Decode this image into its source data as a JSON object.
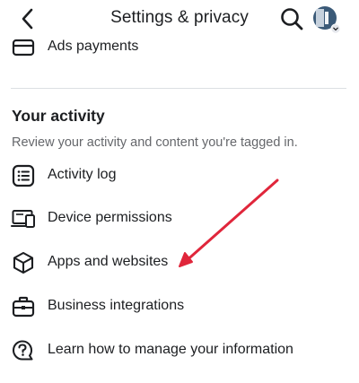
{
  "header": {
    "title": "Settings & privacy",
    "back_icon": "chevron-left-icon",
    "search_icon": "search-icon",
    "avatar_icon": "profile-avatar"
  },
  "top_item": {
    "label": "Ads payments",
    "icon": "card-icon"
  },
  "section": {
    "title": "Your activity",
    "subtitle": "Review your activity and content you're tagged in.",
    "items": [
      {
        "label": "Activity log",
        "icon": "list-icon"
      },
      {
        "label": "Device permissions",
        "icon": "device-icon"
      },
      {
        "label": "Apps and websites",
        "icon": "cube-icon"
      },
      {
        "label": "Business integrations",
        "icon": "briefcase-icon"
      },
      {
        "label": "Learn how to manage your information",
        "icon": "question-bubble-icon"
      }
    ]
  },
  "colors": {
    "text": "#1c1e21",
    "secondary_text": "#65676b",
    "divider": "#dcdfe3",
    "annotation_arrow": "#e0263b",
    "avatar": "#3b5a78"
  }
}
